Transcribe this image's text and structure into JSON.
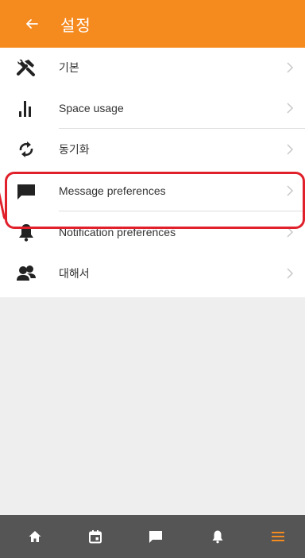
{
  "colors": {
    "accent": "#F58A1F",
    "highlight": "#E0202A",
    "nav_bg": "#555555"
  },
  "header": {
    "title": "설정",
    "back_icon": "arrow-left-icon"
  },
  "settings": [
    {
      "label": "기본",
      "icon": "tools-icon"
    },
    {
      "label": "Space usage",
      "icon": "bar-chart-icon"
    },
    {
      "label": "동기화",
      "icon": "sync-icon"
    },
    {
      "label": "Message preferences",
      "icon": "message-icon"
    },
    {
      "label": "Notification preferences",
      "icon": "bell-icon"
    },
    {
      "label": "대해서",
      "icon": "people-icon"
    }
  ],
  "bottom_nav": [
    {
      "icon": "home-icon",
      "active": false
    },
    {
      "icon": "calendar-icon",
      "active": false
    },
    {
      "icon": "message-icon",
      "active": false
    },
    {
      "icon": "bell-icon",
      "active": false
    },
    {
      "icon": "menu-icon",
      "active": true
    }
  ]
}
